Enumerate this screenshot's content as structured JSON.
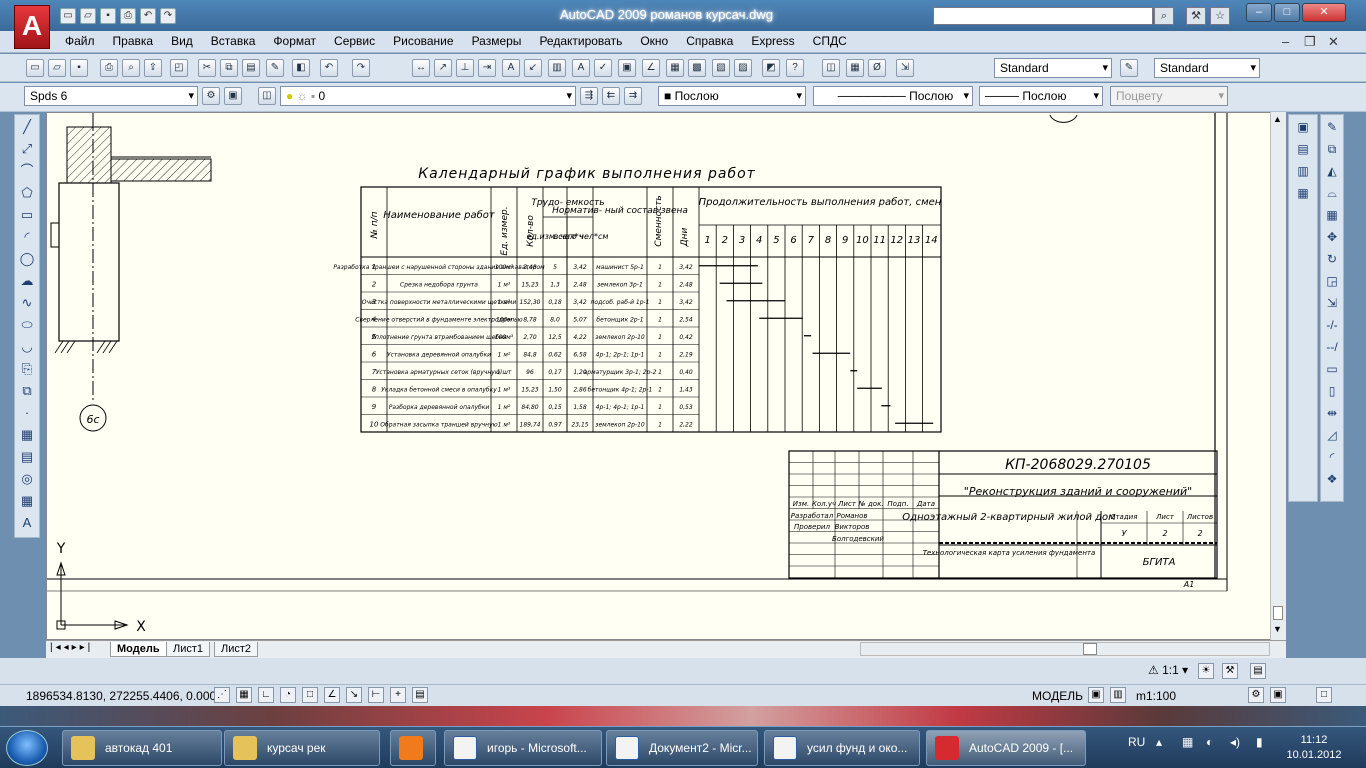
{
  "window": {
    "title": "AutoCAD 2009 романов курсач.dwg",
    "logo": "A",
    "minimize": "–",
    "maximize": "□",
    "close": "✕"
  },
  "menu": [
    "Файл",
    "Правка",
    "Вид",
    "Вставка",
    "Формат",
    "Сервис",
    "Рисование",
    "Размеры",
    "Редактировать",
    "Окно",
    "Справка",
    "Express",
    "СПДС"
  ],
  "mdi": {
    "minimize": "–",
    "restore": "❐",
    "close": "✕"
  },
  "styles": {
    "text_style": "Standard",
    "dim_style": "Standard"
  },
  "layers": {
    "workspace": "Spds 6",
    "layer": "0",
    "color": "Послою",
    "linetype": "Послою",
    "lineweight": "Послою",
    "plotstyle": "Поцвету"
  },
  "drawing": {
    "axis_label": "6с",
    "schedule_title": "Календарный график выполнения работ",
    "headers": {
      "num": "№ п/п",
      "name": "Наименование работ",
      "unit": "Ед. измер.",
      "qty": "Кол-во",
      "labor": "Трудо- емкость",
      "labor_unit": "ед.изм. чел*ч",
      "labor_total": "всего чел*см",
      "crew": "Норматив- ный состав звена",
      "shifts": "Сменность",
      "days": "Дни",
      "duration": "Продолжительность выполнения работ, смен",
      "days_numbers": [
        "1",
        "2",
        "3",
        "4",
        "5",
        "6",
        "7",
        "8",
        "9",
        "10",
        "11",
        "12",
        "13",
        "14"
      ]
    },
    "rows": [
      {
        "n": "1",
        "name": "Разработка траншеи с нарушенной стороны здания экскаватором",
        "unit": "100м³",
        "qty": "3,48",
        "lu": "5",
        "lt": "3,42",
        "crew": "машинист 5р-1",
        "sh": "1",
        "days": "3,42"
      },
      {
        "n": "2",
        "name": "Срезка недобора грунта",
        "unit": "1 м³",
        "qty": "15,23",
        "lu": "1,3",
        "lt": "2,48",
        "crew": "землекоп 3р-1",
        "sh": "1",
        "days": "2,48"
      },
      {
        "n": "3",
        "name": "Очистка поверхности металлическими щетками",
        "unit": "1 м²",
        "qty": "152,30",
        "lu": "0,18",
        "lt": "3,42",
        "crew": "подсоб. раб-й 1р-1",
        "sh": "1",
        "days": "3,42"
      },
      {
        "n": "4",
        "name": "Сверление отверстий в фундаменте электродрелью",
        "unit": "100м",
        "qty": "8,78",
        "lu": "8,0",
        "lt": "5,07",
        "crew": "бетонщик 2р-1",
        "sh": "1",
        "days": "2,54"
      },
      {
        "n": "5",
        "name": "Уплотнение грунта втрамбованием щебня",
        "unit": "100м³",
        "qty": "2,70",
        "lu": "12,5",
        "lt": "4,22",
        "crew": "землекоп 2р-10",
        "sh": "1",
        "days": "0,42"
      },
      {
        "n": "6",
        "name": "Установка деревянной опалубки",
        "unit": "1 м²",
        "qty": "84,8",
        "lu": "0,62",
        "lt": "6,58",
        "crew": "4р-1; 2р-1; 1р-1",
        "sh": "1",
        "days": "2,19"
      },
      {
        "n": "7",
        "name": "Установка арматурных сеток (вручную)",
        "unit": "1 шт",
        "qty": "96",
        "lu": "0,17",
        "lt": "1,20",
        "crew": "арматурщик 3р-1; 2р-2",
        "sh": "1",
        "days": "0,40"
      },
      {
        "n": "8",
        "name": "Укладка бетонной смеси в опалубку",
        "unit": "1 м³",
        "qty": "15,23",
        "lu": "1,50",
        "lt": "2,86",
        "crew": "бетонщик 4р-1; 2р-1",
        "sh": "1",
        "days": "1,43"
      },
      {
        "n": "9",
        "name": "Разборка деревянной опалубки",
        "unit": "1 м²",
        "qty": "84,80",
        "lu": "0,15",
        "lt": "1,58",
        "crew": "4р-1; 4р-1; 1р-1",
        "sh": "1",
        "days": "0,53"
      },
      {
        "n": "10",
        "name": "Обратная засыпка траншей вручную",
        "unit": "1 м³",
        "qty": "189,74",
        "lu": "0,97",
        "lt": "23,15",
        "crew": "землекоп 2р-10",
        "sh": "1",
        "days": "2,22"
      }
    ],
    "gantt": [
      {
        "start": 0,
        "len": 3.42
      },
      {
        "start": 1.2,
        "len": 2.48
      },
      {
        "start": 1.6,
        "len": 3.42
      },
      {
        "start": 3.5,
        "len": 2.54
      },
      {
        "start": 6.1,
        "len": 0.42
      },
      {
        "start": 6.6,
        "len": 2.19
      },
      {
        "start": 8.8,
        "len": 0.4
      },
      {
        "start": 9.2,
        "len": 1.43
      },
      {
        "start": 10.6,
        "len": 0.53
      },
      {
        "start": 11.4,
        "len": 2.22
      }
    ],
    "stamp": {
      "code": "КП-2068029.270105",
      "project": "\"Реконструкция зданий и сооружений\"",
      "object": "Одноэтажный 2-квартирный жилой дом",
      "sheet_title": "Технологическая карта усиления фундамента",
      "org": "БГИТА",
      "col_izm": "Изм.",
      "col_kol": "Кол.уч",
      "col_list": "Лист",
      "col_doc": "№ док.",
      "col_sign": "Подп.",
      "col_date": "Дата",
      "role1": "Разработал",
      "name1": "Романов",
      "role2": "Проверил",
      "name2": "Викторов",
      "name3": "Болгодевский",
      "stage_h": "Стадия",
      "list_h": "Лист",
      "lists_h": "Листов",
      "stage": "У",
      "list": "2",
      "lists": "2",
      "format": "A1"
    },
    "ucs_x": "X",
    "ucs_y": "Y"
  },
  "tabs": [
    "Модель",
    "Лист1",
    "Лист2"
  ],
  "status": {
    "coords": "1896534.8130, 272255.4406, 0.0000",
    "model": "МОДЕЛЬ",
    "scale": "m1:100",
    "anno_scale": "1:1"
  },
  "taskbar": {
    "items": [
      "автокад 401",
      "курсач рек",
      "игорь - Microsoft...",
      "Документ2 - Micr...",
      "усил фунд и око...",
      "AutoCAD 2009 - [..."
    ],
    "lang": "RU",
    "time": "11:12",
    "date": "10.01.2012"
  },
  "colors": {
    "accent": "#3a6a99",
    "logo": "#d52b30",
    "canvas": "#fffff4"
  }
}
